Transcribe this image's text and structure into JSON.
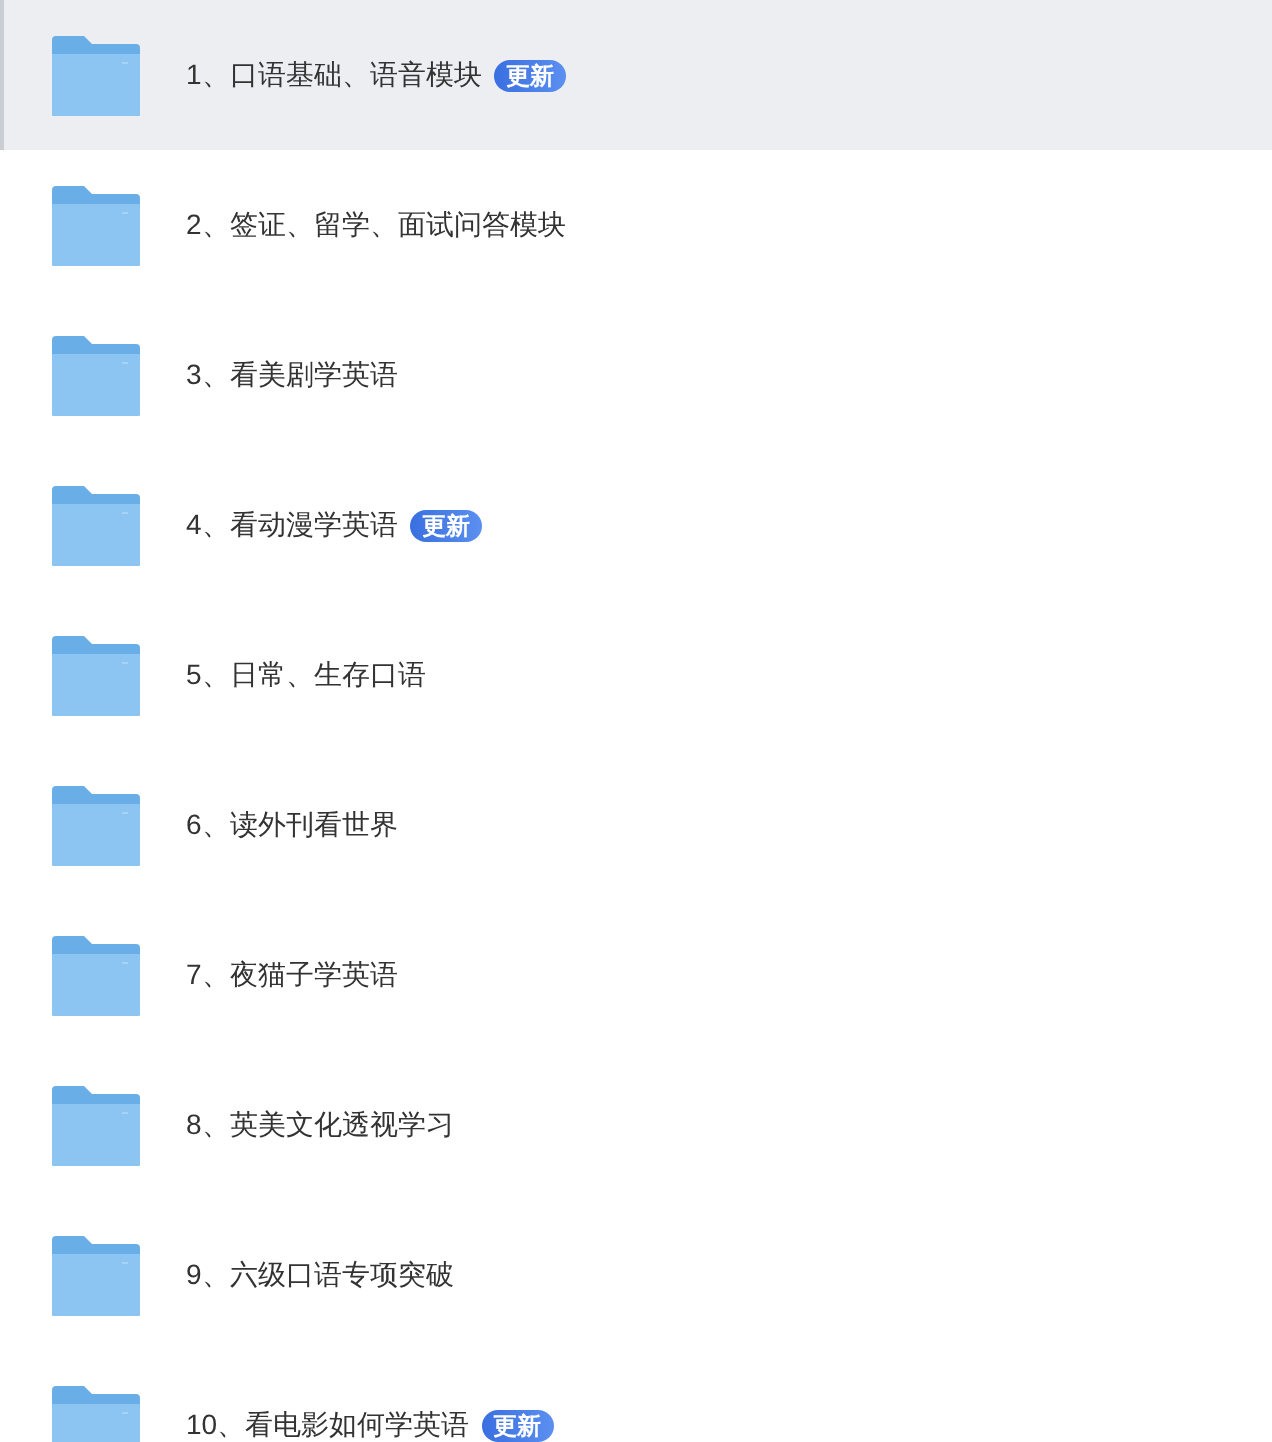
{
  "folders": [
    {
      "name": "1、口语基础、语音模块",
      "badge": "更新",
      "selected": true
    },
    {
      "name": "2、签证、留学、面试问答模块",
      "selected": false
    },
    {
      "name": "3、看美剧学英语",
      "selected": false
    },
    {
      "name": "4、看动漫学英语",
      "badge": "更新",
      "selected": false
    },
    {
      "name": "5、日常、生存口语",
      "selected": false
    },
    {
      "name": "6、读外刊看世界",
      "selected": false
    },
    {
      "name": "7、夜猫子学英语",
      "selected": false
    },
    {
      "name": "8、英美文化透视学习",
      "selected": false
    },
    {
      "name": "9、六级口语专项突破",
      "selected": false
    },
    {
      "name": "10、看电影如何学英语",
      "badge": "更新",
      "selected": false
    }
  ]
}
